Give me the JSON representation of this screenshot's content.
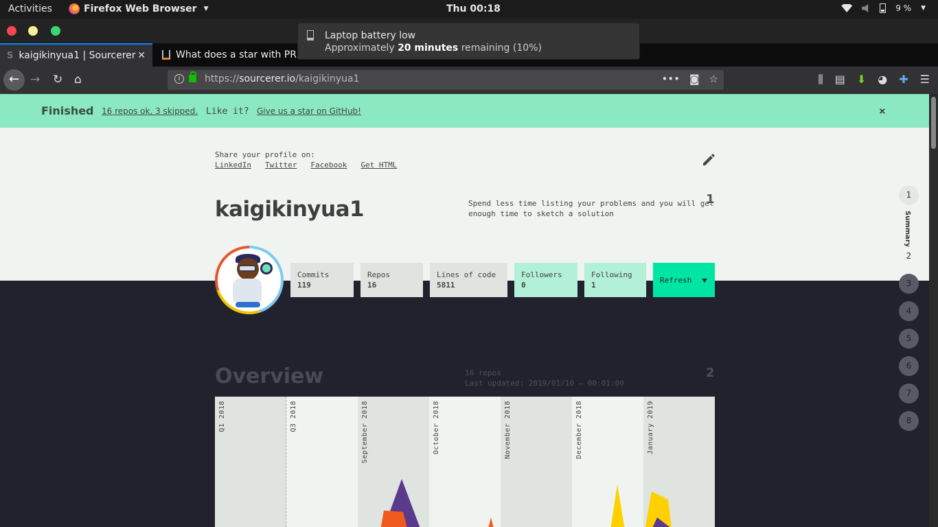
{
  "topbar": {
    "activities": "Activities",
    "app_name": "Firefox Web Browser",
    "clock": "Thu 00:18",
    "battery_pct": "9 %"
  },
  "notification": {
    "title": "Laptop battery low",
    "body_prefix": "Approximately ",
    "body_bold": "20 minutes",
    "body_suffix": " remaining (10%)"
  },
  "tabs": [
    {
      "title": "kaigikinyua1 | Sourcerer"
    },
    {
      "title": "What does a star with PR"
    }
  ],
  "urlbar": {
    "url_scheme": "https://",
    "url_host": "sourcerer.io",
    "url_path": "/kaigikinyua1"
  },
  "banner": {
    "status": "Finished",
    "repos_link": "16 repos ok, 3 skipped.",
    "like_text": "Like it?",
    "star_link": "Give us a star on GitHub!",
    "close": "×"
  },
  "profile": {
    "share_label": "Share your profile on:",
    "share_links": [
      "LinkedIn",
      "Twitter",
      "Facebook",
      "Get HTML"
    ],
    "username": "kaigikinyua1",
    "bio": "Spend less time listing your problems and you will get enough time to sketch a solution",
    "section_number": "1",
    "stats": [
      {
        "label": "Commits",
        "value": "119"
      },
      {
        "label": "Repos",
        "value": "16"
      },
      {
        "label": "Lines of code",
        "value": "5811"
      },
      {
        "label": "Followers",
        "value": "0"
      },
      {
        "label": "Following",
        "value": "1"
      }
    ],
    "refresh_label": "Refresh"
  },
  "sidenav": {
    "items": [
      "1",
      "2",
      "3",
      "4",
      "5",
      "6",
      "7",
      "8"
    ],
    "active_label": "Summary"
  },
  "overview": {
    "title": "Overview",
    "repos": "16 repos",
    "last_updated": "Last updated: 2019/01/10 — 00:01:00",
    "section_number": "2",
    "timeline_labels": [
      "Q1 2018",
      "Q3 2018",
      "September 2018",
      "October 2018",
      "November 2018",
      "December 2018",
      "January 2019"
    ]
  },
  "colors": {
    "banner_bg": "#8ae9c1",
    "accent": "#00e5a3",
    "dark_bg": "#22222f",
    "light_bg": "#eff4f0",
    "chart_purple": "#5b3a8c",
    "chart_orange": "#f05a1e",
    "chart_yellow": "#ffd000"
  }
}
